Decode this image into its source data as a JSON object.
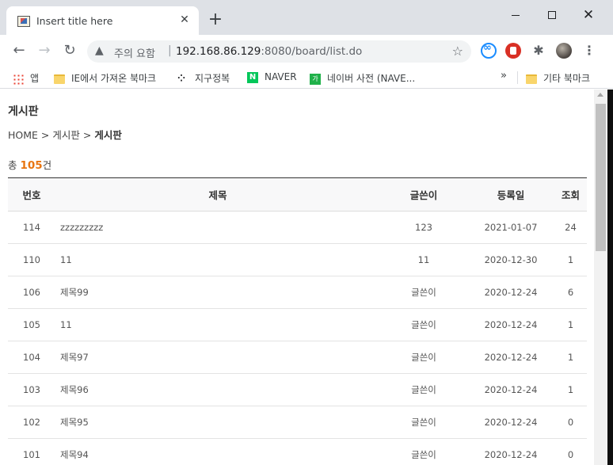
{
  "browser": {
    "tab_title": "Insert title here",
    "tab_close": "✕",
    "new_tab": "+",
    "window": {
      "minimize": "",
      "maximize": "",
      "close": "✕"
    },
    "nav": {
      "back": "←",
      "forward": "→",
      "reload": "↻"
    },
    "address": {
      "security_icon": "▲",
      "security_text": "주의 요함",
      "separator": "|",
      "host": "192.168.86.129",
      "path": ":8080/board/list.do",
      "star": "☆"
    },
    "extensions": {
      "puzzle": "✱",
      "menu": "⋮"
    },
    "bookmarks": [
      {
        "icon": "apps-grid-icon",
        "label": "앱"
      },
      {
        "icon": "folder-icon",
        "label": "IE에서 가져온 북마크"
      },
      {
        "icon": "dots-icon",
        "label": "지구정복"
      },
      {
        "icon": "naver-icon",
        "label": "NAVER"
      },
      {
        "icon": "ka-icon",
        "label": "네이버 사전 (NAVE..."
      }
    ],
    "bookmarks_overflow": "»",
    "other_bookmarks": "기타 북마크"
  },
  "page": {
    "board_title": "게시판",
    "breadcrumb": {
      "home": "HOME",
      "sep": ">",
      "board": "게시판",
      "current": "게시판"
    },
    "total": {
      "prefix": "총 ",
      "count": "105",
      "suffix": "건"
    },
    "table": {
      "headers": {
        "no": "번호",
        "subject": "제목",
        "writer": "글쓴이",
        "date": "등록일",
        "views": "조회"
      },
      "rows": [
        {
          "no": "114",
          "subject": "zzzzzzzzz",
          "writer": "123",
          "date": "2021-01-07",
          "views": "24"
        },
        {
          "no": "110",
          "subject": "11",
          "writer": "11",
          "date": "2020-12-30",
          "views": "1"
        },
        {
          "no": "106",
          "subject": "제목99",
          "writer": "글쓴이",
          "date": "2020-12-24",
          "views": "6"
        },
        {
          "no": "105",
          "subject": "11",
          "writer": "글쓴이",
          "date": "2020-12-24",
          "views": "1"
        },
        {
          "no": "104",
          "subject": "제목97",
          "writer": "글쓴이",
          "date": "2020-12-24",
          "views": "1"
        },
        {
          "no": "103",
          "subject": "제목96",
          "writer": "글쓴이",
          "date": "2020-12-24",
          "views": "1"
        },
        {
          "no": "102",
          "subject": "제목95",
          "writer": "글쓴이",
          "date": "2020-12-24",
          "views": "0"
        },
        {
          "no": "101",
          "subject": "제목94",
          "writer": "글쓴이",
          "date": "2020-12-24",
          "views": "0"
        }
      ]
    }
  },
  "colors": {
    "accent_count": "#e87511",
    "tabstrip_bg": "#dee1e6",
    "header_bg": "#f8f8f9"
  }
}
